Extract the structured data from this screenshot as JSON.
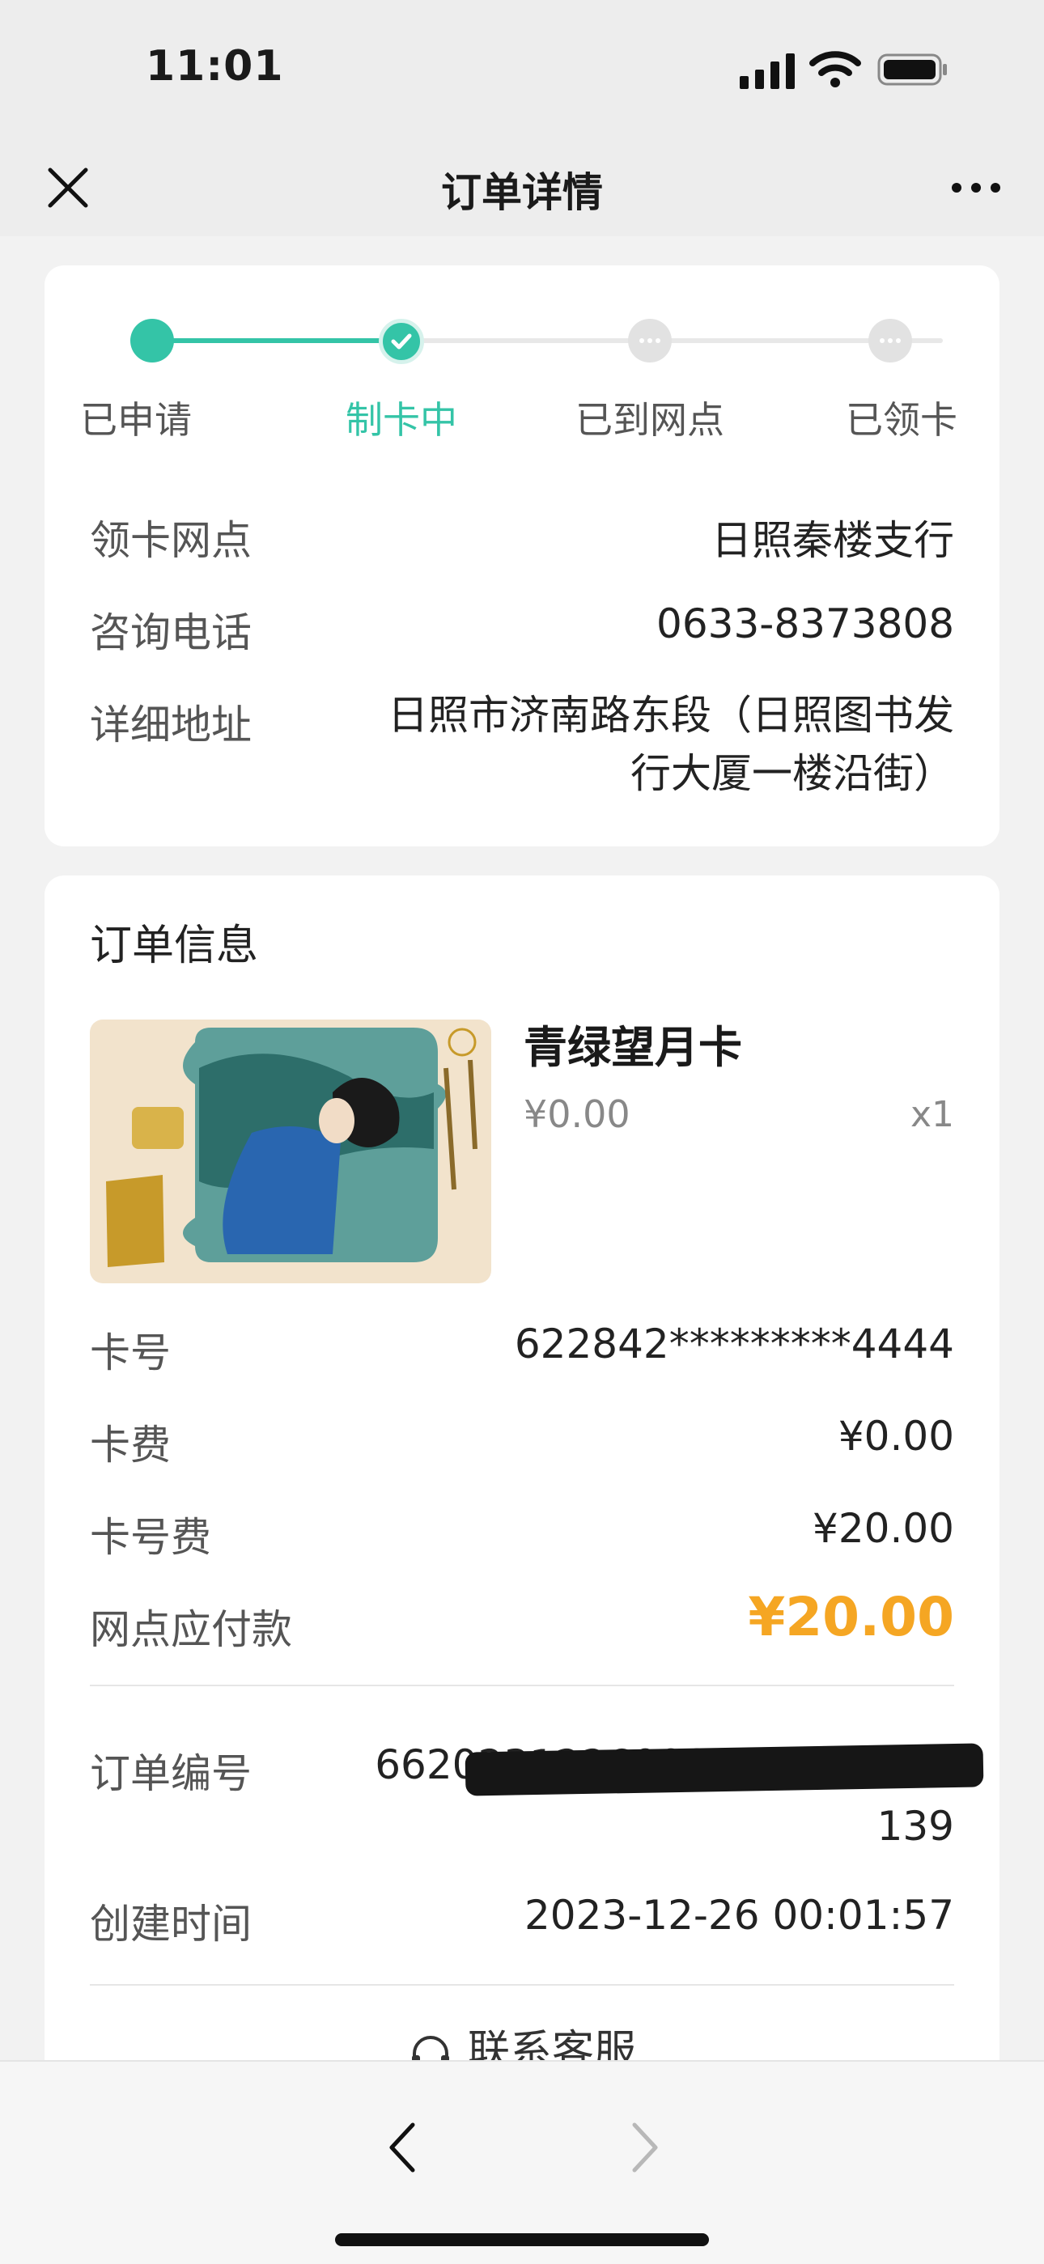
{
  "status_bar": {
    "time": "11:01",
    "icons": [
      "signal-icon",
      "wifi-icon",
      "battery-icon"
    ]
  },
  "nav": {
    "title": "订单详情",
    "close_icon": "close-icon",
    "more_icon": "more-icon"
  },
  "progress": {
    "accent_color": "#34c4a7",
    "current_step": 2,
    "steps": [
      {
        "label": "已申请",
        "state": "done"
      },
      {
        "label": "制卡中",
        "state": "current"
      },
      {
        "label": "已到网点",
        "state": "pending"
      },
      {
        "label": "已领卡",
        "state": "pending"
      }
    ]
  },
  "branch": {
    "pickup_label": "领卡网点",
    "pickup_value": "日照秦楼支行",
    "phone_label": "咨询电话",
    "phone_value": "0633-8373808",
    "address_label": "详细地址",
    "address_value": "日照市济南路东段（日照图书发行大厦一楼沿街）"
  },
  "order": {
    "section_title": "订单信息",
    "product": {
      "name": "青绿望月卡",
      "price": "¥0.00",
      "qty": "x1"
    },
    "card_no_label": "卡号",
    "card_no_value": "622842*********4444",
    "card_fee_label": "卡费",
    "card_fee_value": "¥0.00",
    "number_fee_label": "卡号费",
    "number_fee_value": "¥20.00",
    "payable_label": "网点应付款",
    "payable_value": "¥20.00",
    "payable_color": "#f5a623",
    "order_no_label": "订单编号",
    "order_no_value_line1": "66202312260001573366 72",
    "order_no_value_line2": "139",
    "created_label": "创建时间",
    "created_value": "2023-12-26 00:01:57",
    "service_label": "联系客服",
    "service_icon": "headset-icon"
  },
  "toolbar": {
    "back_icon": "chevron-left-icon",
    "forward_icon": "chevron-right-icon"
  }
}
